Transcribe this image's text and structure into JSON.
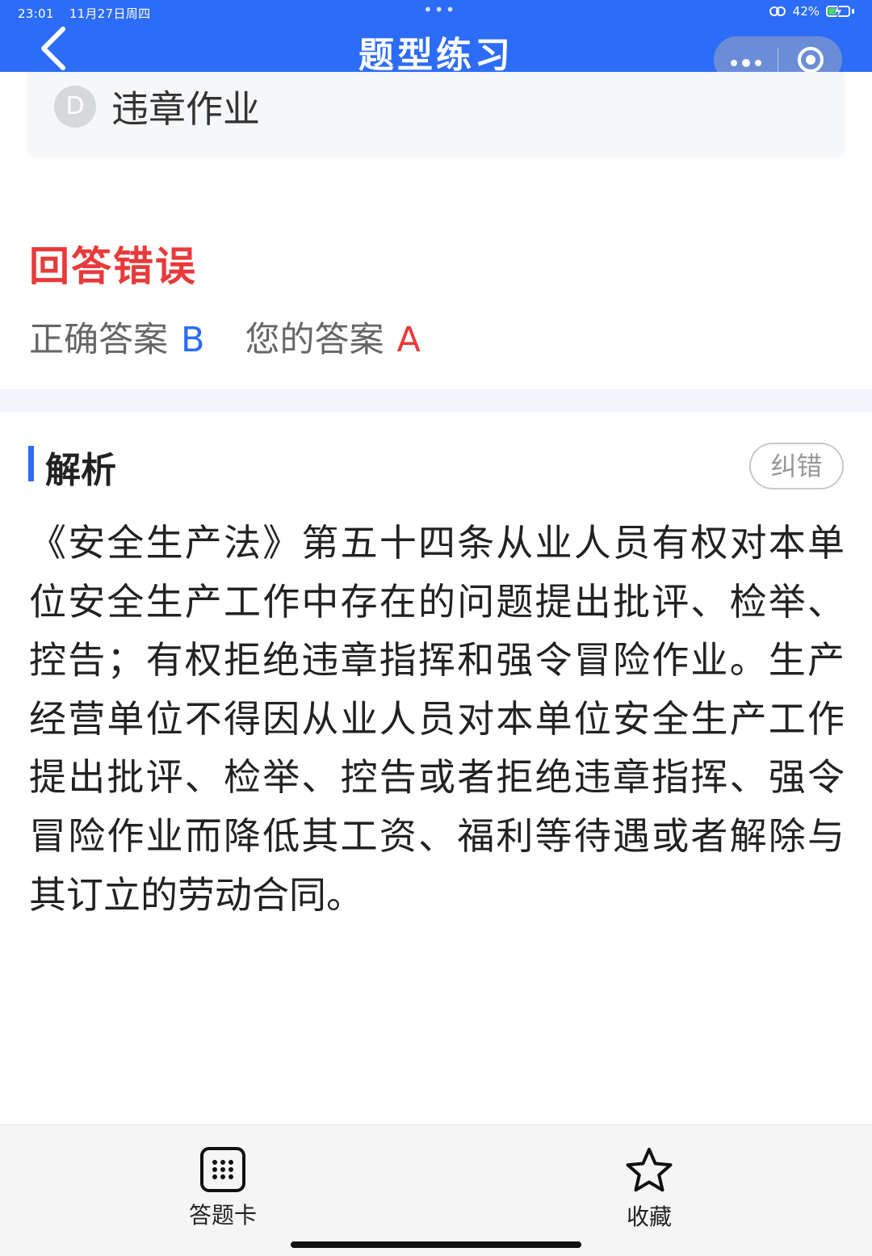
{
  "status_bar": {
    "time": "23:01",
    "date": "11月27日周四",
    "battery": "42%"
  },
  "header": {
    "title": "题型练习"
  },
  "option": {
    "letter": "D",
    "text": "违章作业"
  },
  "result": {
    "title": "回答错误",
    "correct_label": "正确答案",
    "correct_value": "B",
    "your_label": "您的答案",
    "your_value": "A"
  },
  "analysis": {
    "title": "解析",
    "report_label": "纠错",
    "text": "《安全生产法》第五十四条从业人员有权对本单位安全生产工作中存在的问题提出批评、检举、控告；有权拒绝违章指挥和强令冒险作业。生产经营单位不得因从业人员对本单位安全生产工作提出批评、检举、控告或者拒绝违章指挥、强令冒险作业而降低其工资、福利等待遇或者解除与其订立的劳动合同。"
  },
  "bottom_tabs": {
    "answer_card": "答题卡",
    "favorite": "收藏"
  },
  "colors": {
    "primary": "#2c6cf6",
    "error": "#e83a3a"
  }
}
